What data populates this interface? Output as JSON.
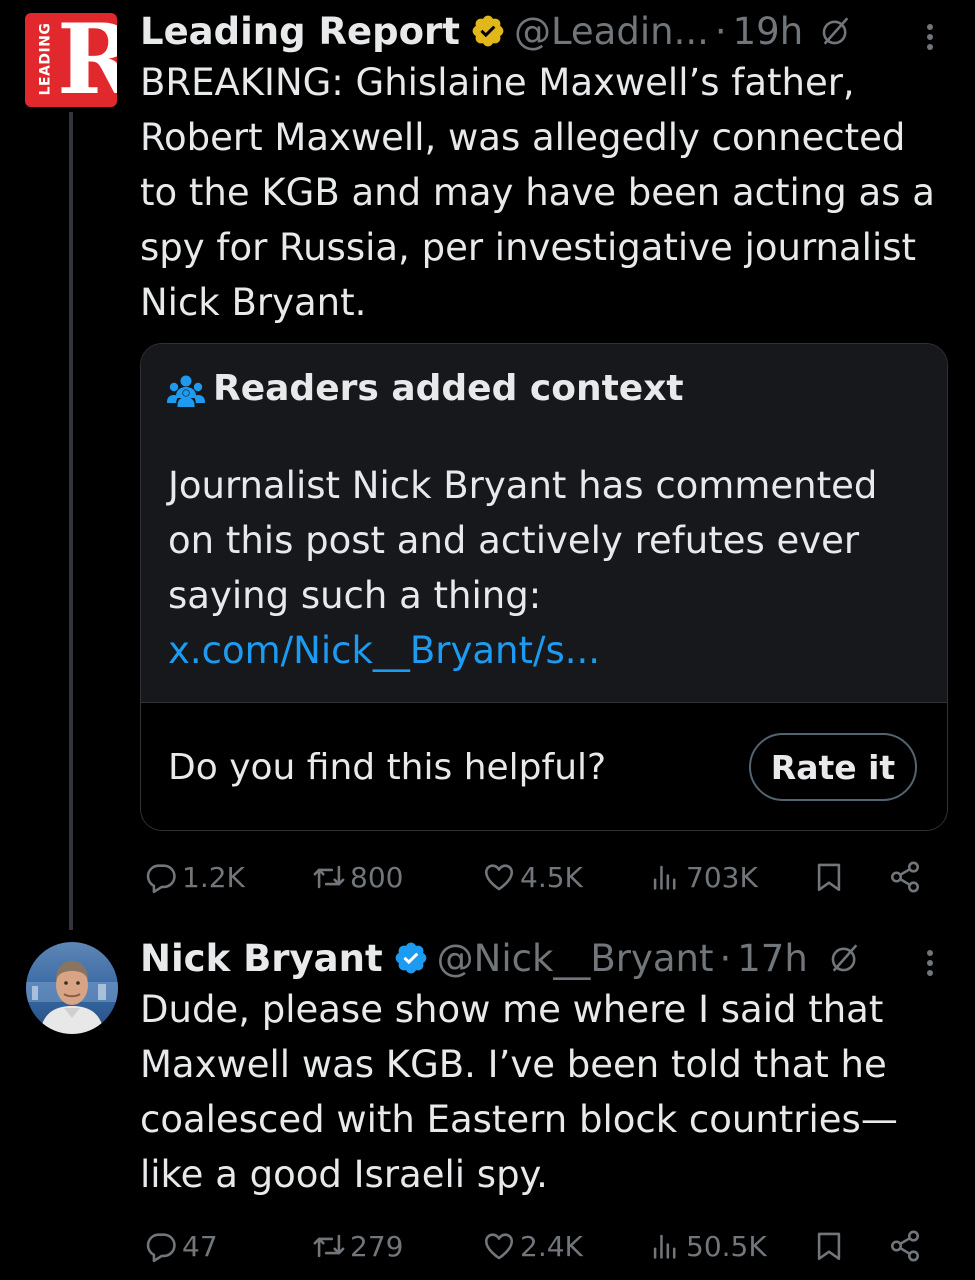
{
  "tweet1": {
    "author_name": "Leading Report",
    "handle": "@Leadin...",
    "time": "19h",
    "avatar_text": "R",
    "avatar_small_text": "LEADING",
    "text": "BREAKING: Ghislaine Maxwell’s father, Robert Maxwell, was allegedly connected to the KGB and may have been acting as a spy for Russia, per investigative journalist Nick Bryant.",
    "badge_color": "#e2b719",
    "community_note": {
      "title": "Readers added context",
      "text": "Journalist Nick Bryant has commented on this post and actively refutes ever saying such a thing:",
      "link": "x.com/Nick__Bryant/s...",
      "prompt": "Do you find this helpful?",
      "button": "Rate it"
    },
    "actions": {
      "replies": "1.2K",
      "reposts": "800",
      "likes": "4.5K",
      "views": "703K"
    }
  },
  "tweet2": {
    "author_name": "Nick Bryant",
    "handle": "@Nick__Bryant",
    "time": "17h",
    "text": "Dude, please show me where I said that Maxwell was KGB. I’ve been told that he coalesced with Eastern block countries—like a good Israeli spy.",
    "badge_color": "#1d9bf0",
    "actions": {
      "replies": "47",
      "reposts": "279",
      "likes": "2.4K",
      "views": "50.5K"
    }
  },
  "colors": {
    "background": "#000000",
    "text": "#e7e9ea",
    "muted": "#71767b",
    "link": "#1d9bf0",
    "avatar_red": "#e0282d"
  }
}
